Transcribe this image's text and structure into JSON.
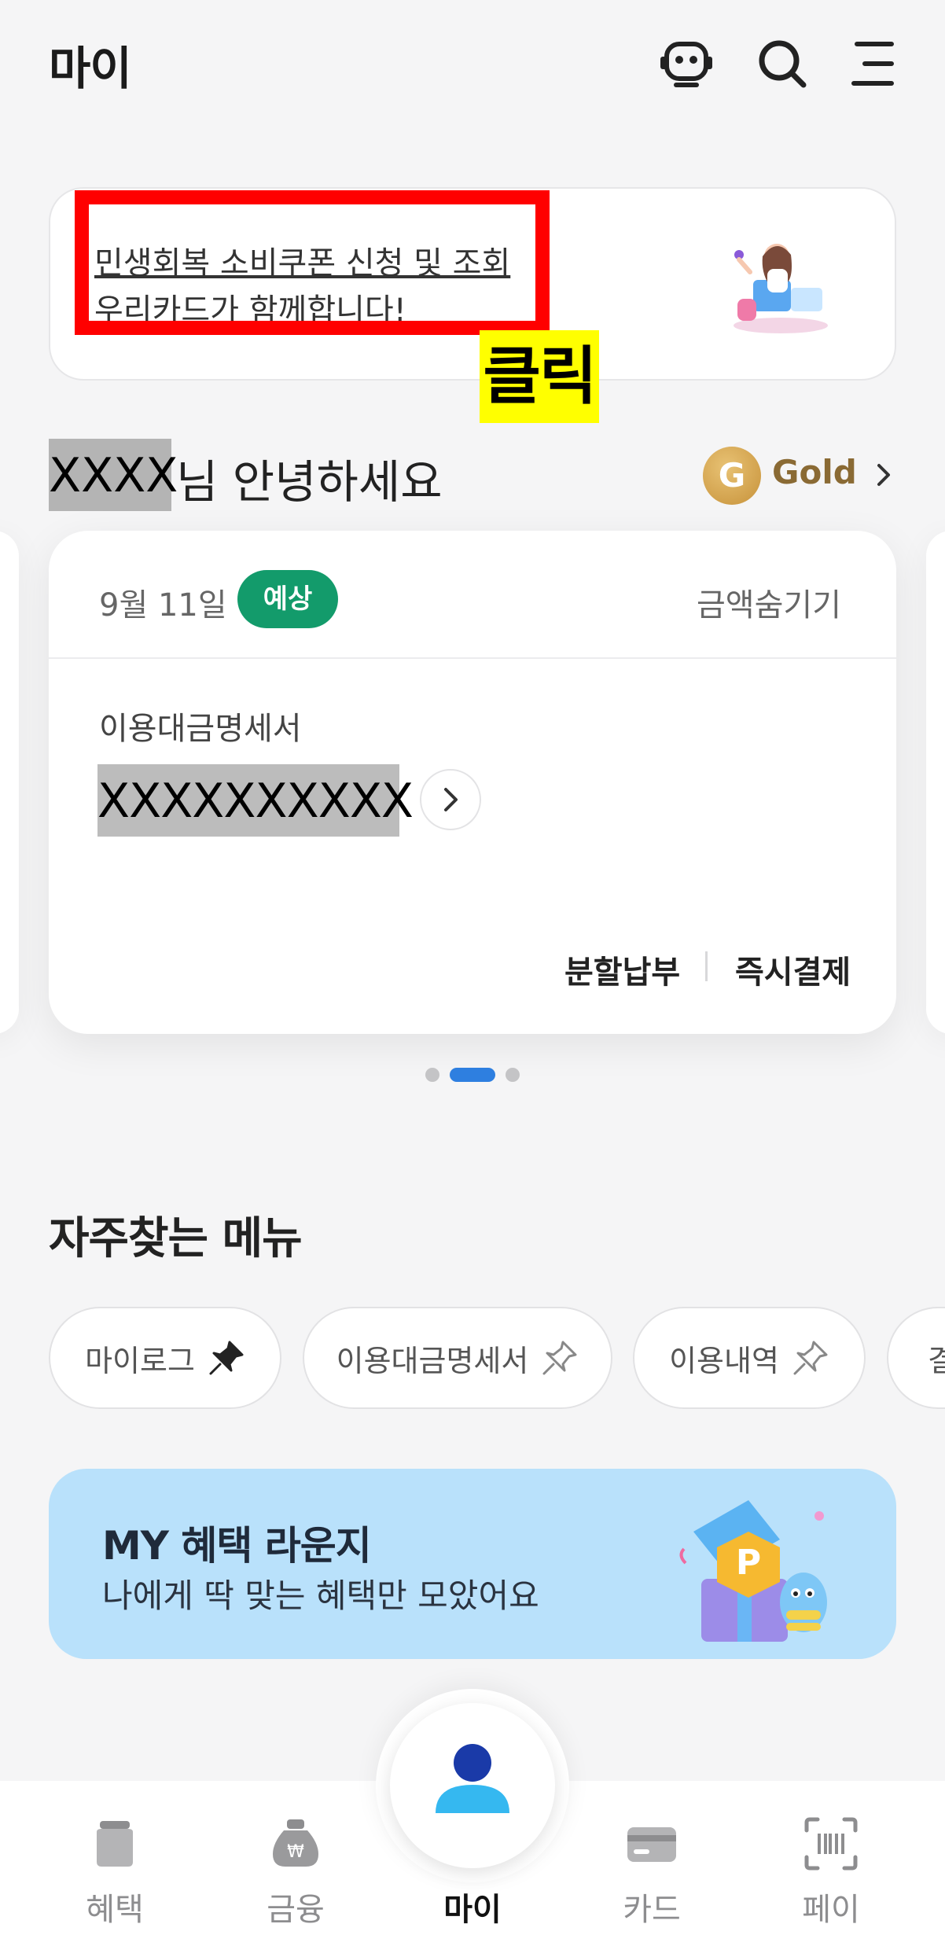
{
  "header": {
    "title": "마이",
    "icons": [
      "chatbot-icon",
      "search-icon",
      "menu-icon"
    ]
  },
  "promo": {
    "line1": "민생회복 소비쿠폰 신청 및 조회",
    "line2": "우리카드가 함께합니다!",
    "annotation": "클릭"
  },
  "greeting": {
    "name_masked": "XXXX",
    "text": "님 안녕하세요",
    "grade_letter": "G",
    "grade": "Gold"
  },
  "bill_card": {
    "date": "9월 11일",
    "badge": "예상",
    "hide_amount": "금액숨기기",
    "statement_label": "이용대금명세서",
    "amount_masked": "XXXXXXXXXX",
    "action_installment": "분할납부",
    "action_pay_now": "즉시결제"
  },
  "carousel": {
    "total": 3,
    "active_index": 1
  },
  "frequent_menu": {
    "title": "자주찾는 메뉴",
    "chips": [
      {
        "label": "마이로그",
        "pinned": true
      },
      {
        "label": "이용대금명세서",
        "pinned": false
      },
      {
        "label": "이용내역",
        "pinned": false
      },
      {
        "label": "결",
        "pinned": false
      }
    ]
  },
  "benefit_banner": {
    "title": "MY 혜택 라운지",
    "subtitle": "나에게 딱 맞는 혜택만 모았어요"
  },
  "bottom_nav": {
    "items": [
      {
        "label": "혜택",
        "active": false
      },
      {
        "label": "금융",
        "active": false
      },
      {
        "label": "마이",
        "active": true
      },
      {
        "label": "카드",
        "active": false
      },
      {
        "label": "페이",
        "active": false
      }
    ]
  },
  "colors": {
    "background": "#f5f5f6",
    "badge_green": "#139b6b",
    "highlight_red": "#ff0000",
    "highlight_yellow": "#ffff00",
    "benefit_blue": "#b9e1fb",
    "gold": "#8a6a34",
    "carousel_active": "#2e7fe0",
    "nav_active_blue": "#1a3aa8"
  }
}
